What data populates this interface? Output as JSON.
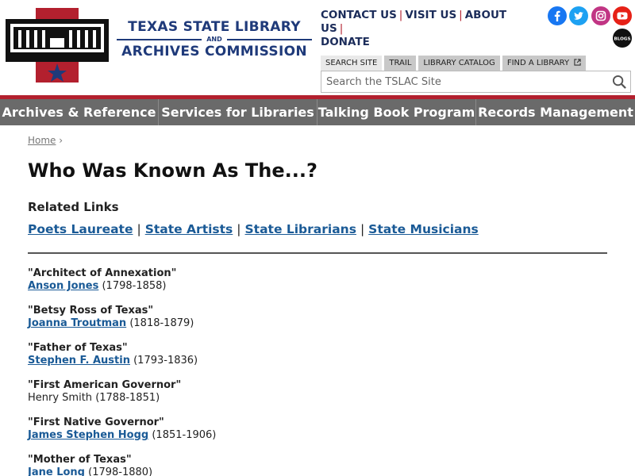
{
  "header": {
    "org_line1": "TEXAS STATE LIBRARY",
    "org_and": "AND",
    "org_line2": "ARCHIVES COMMISSION",
    "toplinks": [
      "CONTACT US",
      "VISIT US",
      "ABOUT US",
      "DONATE"
    ],
    "toplink_separator": "|",
    "social": [
      {
        "icon": "facebook-icon",
        "color": "#1877f2"
      },
      {
        "icon": "twitter-icon",
        "color": "#1da1f2"
      },
      {
        "icon": "instagram-icon",
        "color": "#c13584"
      },
      {
        "icon": "youtube-icon",
        "color": "#e62117"
      },
      {
        "icon": "blogs-icon",
        "label": "BLOGS",
        "color": "#111111"
      }
    ],
    "search_tabs": [
      {
        "label": "SEARCH SITE",
        "active": true
      },
      {
        "label": "TRAIL",
        "active": false
      },
      {
        "label": "LIBRARY CATALOG",
        "active": false
      },
      {
        "label": "FIND A LIBRARY",
        "active": false
      }
    ],
    "search_placeholder": "Search the TSLAC Site"
  },
  "nav": {
    "items": [
      "Archives & Reference",
      "Services for Libraries",
      "Talking Book Program",
      "Records Management"
    ]
  },
  "breadcrumb": {
    "home": "Home",
    "sep": "›"
  },
  "page": {
    "title": "Who Was Known As The...?",
    "related_heading": "Related Links",
    "related_links": [
      "Poets Laureate",
      "State Artists",
      "State Librarians",
      "State Musicians"
    ],
    "related_sep": "|"
  },
  "entries": [
    {
      "nickname": "\"Architect of Annexation\"",
      "name": "Anson Jones",
      "years": "(1798-1858)",
      "linked": true
    },
    {
      "nickname": "\"Betsy Ross of Texas\"",
      "name": "Joanna Troutman",
      "years": "(1818-1879)",
      "linked": true
    },
    {
      "nickname": "\"Father of Texas\"",
      "name": "Stephen F. Austin",
      "years": "(1793-1836)",
      "linked": true
    },
    {
      "nickname": "\"First American Governor\"",
      "name": "Henry Smith",
      "years": "(1788-1851)",
      "linked": false
    },
    {
      "nickname": "\"First Native Governor\"",
      "name": "James Stephen Hogg",
      "years": "(1851-1906)",
      "linked": true
    },
    {
      "nickname": "\"Mother of Texas\"",
      "name": "Jane Long",
      "years": "(1798-1880)",
      "linked": true
    }
  ],
  "colors": {
    "brand_navy": "#1f3a7a",
    "accent_red": "#b3202e",
    "nav_gray": "#6a6a6a",
    "link_blue": "#1a5a96"
  }
}
